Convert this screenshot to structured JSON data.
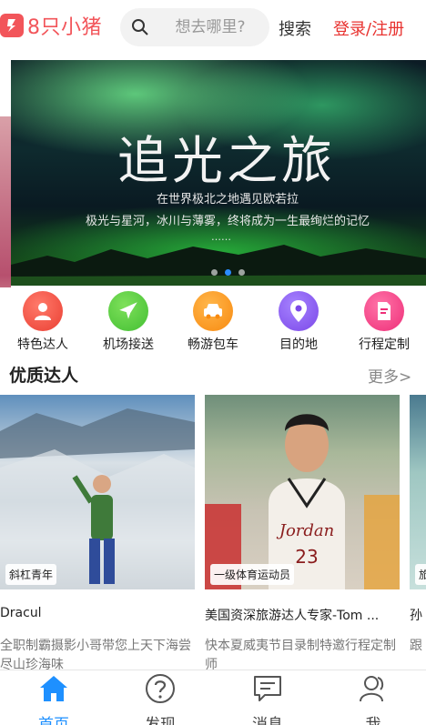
{
  "header": {
    "logo_text": "8只小猪",
    "search_placeholder": "想去哪里?",
    "search_label": "搜索",
    "login_label": "登录/注册",
    "brand_color": "#f2555a"
  },
  "banner": {
    "title": "追光之旅",
    "subtitle_1": "在世界极北之地遇见欧若拉",
    "subtitle_2": "极光与星河，冰川与薄雾，终将成为一生最绚烂的记忆",
    "ellipsis": "……",
    "slide_count": 3,
    "active_slide": 2
  },
  "categories": [
    {
      "label": "特色达人",
      "icon": "person-icon",
      "color": "#f25a4a"
    },
    {
      "label": "机场接送",
      "icon": "airplane-icon",
      "color": "#5ccf45"
    },
    {
      "label": "畅游包车",
      "icon": "car-icon",
      "color": "#ff9a1e"
    },
    {
      "label": "目的地",
      "icon": "location-pin-icon",
      "color": "#8e5ff0"
    },
    {
      "label": "行程定制",
      "icon": "document-edit-icon",
      "color": "#f5468a"
    }
  ],
  "section": {
    "title": "优质达人",
    "more_label": "更多>"
  },
  "experts": [
    {
      "tag": "斜杠青年",
      "name": "Dracul",
      "desc": "全职制霸摄影小哥带您上天下海尝尽山珍海味"
    },
    {
      "tag": "一级体育运动员",
      "name": "美国资深旅游达人专家-Tom ...",
      "desc": "快本夏威夷节目录制特邀行程定制师"
    },
    {
      "tag": "旅",
      "name": "孙",
      "desc": "跟"
    }
  ],
  "tabbar": {
    "items": [
      {
        "label": "首页",
        "icon": "home-icon",
        "active": true
      },
      {
        "label": "发现",
        "icon": "question-circle-icon",
        "active": false
      },
      {
        "label": "消息",
        "icon": "message-icon",
        "active": false
      },
      {
        "label": "我",
        "icon": "user-icon",
        "active": false
      }
    ],
    "active_color": "#1e90ff"
  }
}
